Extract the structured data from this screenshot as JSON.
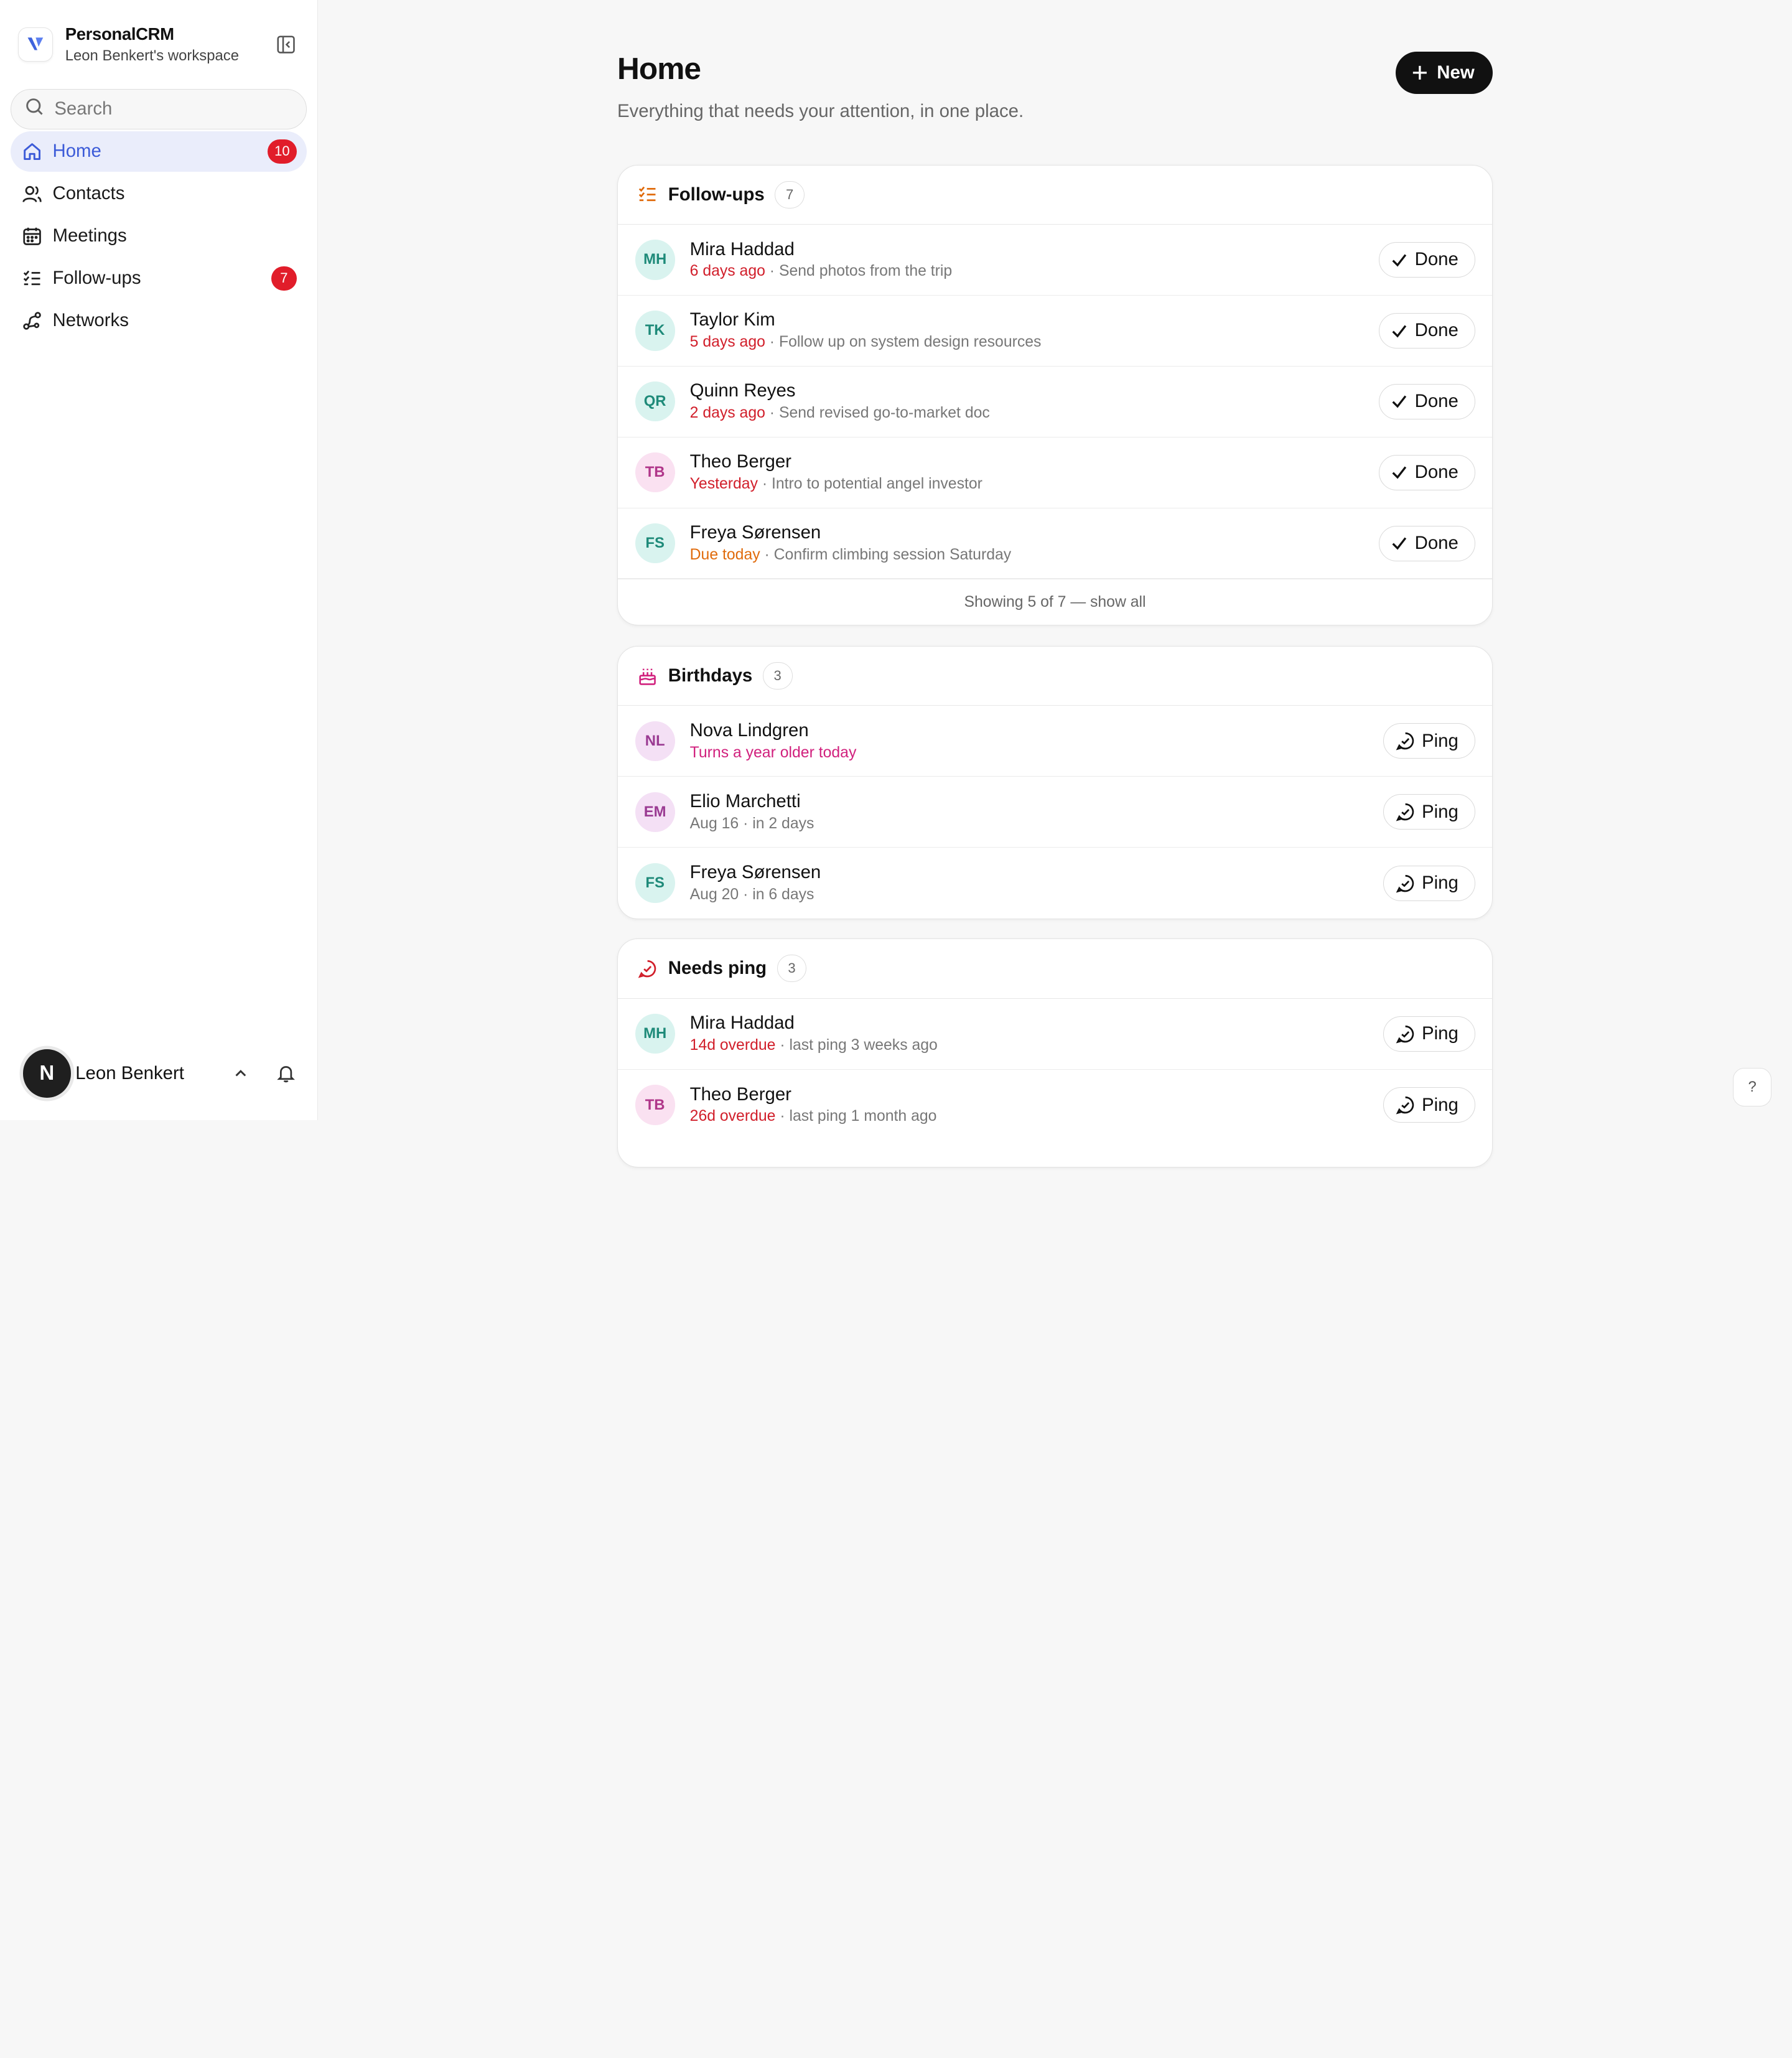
{
  "workspace": {
    "name": "PersonalCRM",
    "subtitle": "Leon Benkert's workspace"
  },
  "search": {
    "placeholder": "Search"
  },
  "nav": [
    {
      "label": "Home",
      "badge": "10",
      "active": true
    },
    {
      "label": "Contacts"
    },
    {
      "label": "Meetings"
    },
    {
      "label": "Follow-ups",
      "badge": "7"
    },
    {
      "label": "Networks"
    }
  ],
  "user": {
    "initial": "N",
    "name": "Leon Benkert"
  },
  "header": {
    "title": "Home",
    "subtitle": "Everything that needs your attention, in one place.",
    "new_label": "New"
  },
  "followups": {
    "title": "Follow-ups",
    "count": "7",
    "button_label": "Done",
    "rows": [
      {
        "initials": "MH",
        "name": "Mira Haddad",
        "when": "6 days ago",
        "sep": " · ",
        "note": "Send photos from the trip"
      },
      {
        "initials": "TK",
        "name": "Taylor Kim",
        "when": "5 days ago",
        "sep": " · ",
        "note": "Follow up on system design resources"
      },
      {
        "initials": "QR",
        "name": "Quinn Reyes",
        "when": "2 days ago",
        "sep": " · ",
        "note": "Send revised go-to-market doc"
      },
      {
        "initials": "TB",
        "name": "Theo Berger",
        "when": "Yesterday",
        "sep": " · ",
        "note": "Intro to potential angel investor"
      },
      {
        "initials": "FS",
        "name": "Freya Sørensen",
        "when": "Due today",
        "sep": " · ",
        "note": "Confirm climbing session Saturday"
      }
    ],
    "footer": "Showing 5 of 7 — show all"
  },
  "birthdays": {
    "title": "Birthdays",
    "count": "3",
    "button_label": "Ping",
    "rows": [
      {
        "initials": "NL",
        "name": "Nova Lindgren",
        "meta": "Turns a year older today"
      },
      {
        "initials": "EM",
        "name": "Elio Marchetti",
        "meta": "Aug 16 · in 2 days"
      },
      {
        "initials": "FS",
        "name": "Freya Sørensen",
        "meta": "Aug 20 · in 6 days"
      }
    ]
  },
  "needs_ping": {
    "title": "Needs ping",
    "count": "3",
    "button_label": "Ping",
    "rows": [
      {
        "initials": "MH",
        "name": "Mira Haddad",
        "overdue": "14d overdue",
        "sep": " · ",
        "note": "last ping 3 weeks ago"
      },
      {
        "initials": "TB",
        "name": "Theo Berger",
        "overdue": "26d overdue",
        "sep": " · ",
        "note": "last ping 1 month ago"
      }
    ]
  },
  "help": {
    "label": "?"
  },
  "colors": {
    "accent": "#3c5bd8",
    "badge": "#e11d2a",
    "overdue": "#d11e2a",
    "due_today": "#e06b0c",
    "birthday": "#d1207d"
  }
}
